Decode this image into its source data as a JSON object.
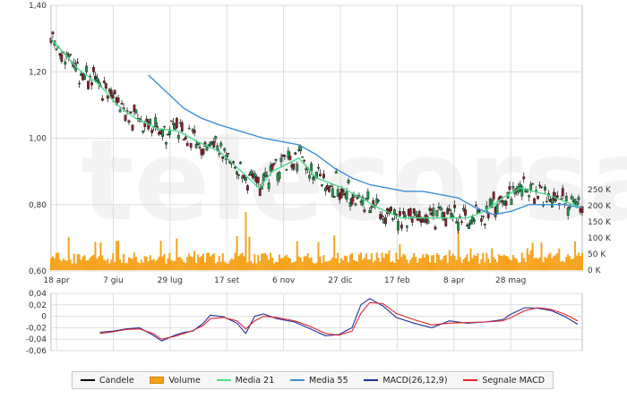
{
  "chart_data": [
    {
      "type": "candlestick",
      "title": "",
      "y_axis_left": {
        "min": 0.6,
        "max": 1.4,
        "ticks": [
          "1,40",
          "1,20",
          "1,00",
          "0,80",
          "0,60"
        ]
      },
      "volume_axis_right": {
        "min": 0,
        "max": 300000,
        "ticks": [
          "250 K",
          "200 K",
          "150 K",
          "100 K",
          "50 K",
          "0 K"
        ]
      },
      "x_tick_labels": [
        "18 apr",
        "7 giu",
        "29 lug",
        "17 set",
        "6 nov",
        "27 dic",
        "17 feb",
        "8 apr",
        "28 mag"
      ],
      "grid": true,
      "watermark": "telecorsa",
      "series": [
        {
          "name": "Media 21",
          "color": "#4fdc8f",
          "points": [
            [
              0,
              1.3
            ],
            [
              30,
              1.21
            ],
            [
              55,
              1.16
            ],
            [
              75,
              1.1
            ],
            [
              95,
              1.06
            ],
            [
              120,
              1.03
            ],
            [
              145,
              1.02
            ],
            [
              165,
              0.99
            ],
            [
              190,
              0.96
            ],
            [
              215,
              0.9
            ],
            [
              235,
              0.85
            ],
            [
              250,
              0.9
            ],
            [
              280,
              0.94
            ],
            [
              300,
              0.88
            ],
            [
              330,
              0.85
            ],
            [
              350,
              0.82
            ],
            [
              370,
              0.79
            ],
            [
              395,
              0.76
            ],
            [
              420,
              0.76
            ],
            [
              450,
              0.76
            ],
            [
              470,
              0.76
            ],
            [
              490,
              0.78
            ],
            [
              510,
              0.82
            ],
            [
              530,
              0.85
            ],
            [
              560,
              0.83
            ],
            [
              580,
              0.81
            ],
            [
              600,
              0.79
            ]
          ]
        },
        {
          "name": "Media 55",
          "color": "#3b8fd8",
          "points": [
            [
              110,
              1.19
            ],
            [
              130,
              1.14
            ],
            [
              150,
              1.09
            ],
            [
              170,
              1.06
            ],
            [
              190,
              1.04
            ],
            [
              215,
              1.02
            ],
            [
              240,
              1.0
            ],
            [
              260,
              0.99
            ],
            [
              280,
              0.98
            ],
            [
              300,
              0.95
            ],
            [
              320,
              0.91
            ],
            [
              340,
              0.88
            ],
            [
              360,
              0.86
            ],
            [
              380,
              0.85
            ],
            [
              400,
              0.84
            ],
            [
              420,
              0.84
            ],
            [
              440,
              0.83
            ],
            [
              460,
              0.82
            ],
            [
              480,
              0.79
            ],
            [
              500,
              0.77
            ],
            [
              520,
              0.78
            ],
            [
              540,
              0.8
            ],
            [
              560,
              0.8
            ],
            [
              580,
              0.8
            ],
            [
              600,
              0.79
            ]
          ]
        }
      ]
    },
    {
      "type": "line",
      "title": "",
      "y_axis": {
        "min": -0.06,
        "max": 0.04,
        "ticks": [
          "0,04",
          "0,02",
          "0",
          "-0,02",
          "-0,04",
          "-0,06"
        ]
      },
      "grid": true,
      "series": [
        {
          "name": "MACD(26,12,9)",
          "color": "#1f2f9f",
          "points": [
            [
              55,
              -0.028
            ],
            [
              70,
              -0.026
            ],
            [
              85,
              -0.022
            ],
            [
              100,
              -0.02
            ],
            [
              115,
              -0.033
            ],
            [
              125,
              -0.043
            ],
            [
              140,
              -0.033
            ],
            [
              150,
              -0.028
            ],
            [
              160,
              -0.026
            ],
            [
              172,
              -0.012
            ],
            [
              180,
              0.002
            ],
            [
              195,
              -0.001
            ],
            [
              210,
              -0.012
            ],
            [
              220,
              -0.03
            ],
            [
              230,
              0.0
            ],
            [
              240,
              0.004
            ],
            [
              255,
              -0.004
            ],
            [
              275,
              -0.01
            ],
            [
              290,
              -0.02
            ],
            [
              310,
              -0.034
            ],
            [
              325,
              -0.032
            ],
            [
              340,
              -0.02
            ],
            [
              350,
              0.02
            ],
            [
              360,
              0.031
            ],
            [
              375,
              0.018
            ],
            [
              390,
              -0.002
            ],
            [
              410,
              -0.012
            ],
            [
              430,
              -0.02
            ],
            [
              450,
              -0.008
            ],
            [
              470,
              -0.012
            ],
            [
              490,
              -0.01
            ],
            [
              510,
              -0.006
            ],
            [
              520,
              0.004
            ],
            [
              535,
              0.015
            ],
            [
              550,
              0.014
            ],
            [
              565,
              0.01
            ],
            [
              580,
              0.0
            ],
            [
              595,
              -0.014
            ]
          ]
        },
        {
          "name": "Segnale MACD",
          "color": "#e0262c",
          "points": [
            [
              55,
              -0.03
            ],
            [
              70,
              -0.027
            ],
            [
              85,
              -0.023
            ],
            [
              100,
              -0.022
            ],
            [
              115,
              -0.03
            ],
            [
              125,
              -0.04
            ],
            [
              140,
              -0.035
            ],
            [
              150,
              -0.03
            ],
            [
              160,
              -0.025
            ],
            [
              172,
              -0.016
            ],
            [
              180,
              -0.004
            ],
            [
              195,
              -0.002
            ],
            [
              210,
              -0.008
            ],
            [
              220,
              -0.022
            ],
            [
              230,
              -0.008
            ],
            [
              240,
              0.0
            ],
            [
              255,
              -0.002
            ],
            [
              275,
              -0.008
            ],
            [
              290,
              -0.016
            ],
            [
              310,
              -0.03
            ],
            [
              325,
              -0.033
            ],
            [
              340,
              -0.026
            ],
            [
              350,
              0.005
            ],
            [
              360,
              0.024
            ],
            [
              375,
              0.022
            ],
            [
              390,
              0.005
            ],
            [
              410,
              -0.006
            ],
            [
              430,
              -0.015
            ],
            [
              450,
              -0.012
            ],
            [
              470,
              -0.011
            ],
            [
              490,
              -0.01
            ],
            [
              510,
              -0.008
            ],
            [
              520,
              -0.002
            ],
            [
              535,
              0.01
            ],
            [
              550,
              0.015
            ],
            [
              565,
              0.012
            ],
            [
              580,
              0.004
            ],
            [
              595,
              -0.008
            ]
          ]
        }
      ]
    }
  ],
  "legend": [
    {
      "label": "Candele",
      "color": "#000000",
      "kind": "line"
    },
    {
      "label": "Volume",
      "color": "#f7a21b",
      "kind": "box"
    },
    {
      "label": "Media 21",
      "color": "#4fdc8f",
      "kind": "line"
    },
    {
      "label": "Media 55",
      "color": "#3b8fd8",
      "kind": "line"
    },
    {
      "label": "MACD(26,12,9)",
      "color": "#1f2f9f",
      "kind": "line"
    },
    {
      "label": "Segnale MACD",
      "color": "#e0262c",
      "kind": "line"
    }
  ],
  "colors": {
    "up": "#1f9a4a",
    "down": "#8b1f2a",
    "volume": "#f7a21b",
    "grid": "#dddddd"
  }
}
